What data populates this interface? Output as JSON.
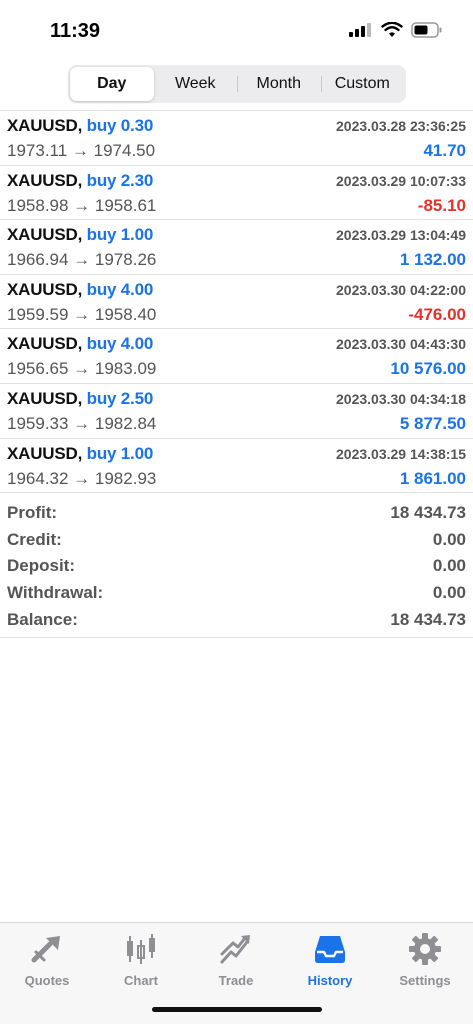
{
  "status": {
    "time": "11:39"
  },
  "segments": [
    "Day",
    "Week",
    "Month",
    "Custom"
  ],
  "deals": [
    {
      "symbol": "XAUUSD,",
      "side": "buy 0.30",
      "prices": "1973.11 → 1974.50",
      "date": "2023.03.28 23:36:25",
      "profit": "41.70",
      "sign": "pos"
    },
    {
      "symbol": "XAUUSD,",
      "side": "buy 2.30",
      "prices": "1958.98 → 1958.61",
      "date": "2023.03.29 10:07:33",
      "profit": "-85.10",
      "sign": "neg"
    },
    {
      "symbol": "XAUUSD,",
      "side": "buy 1.00",
      "prices": "1966.94 → 1978.26",
      "date": "2023.03.29 13:04:49",
      "profit": "1 132.00",
      "sign": "pos"
    },
    {
      "symbol": "XAUUSD,",
      "side": "buy 4.00",
      "prices": "1959.59 → 1958.40",
      "date": "2023.03.30 04:22:00",
      "profit": "-476.00",
      "sign": "neg"
    },
    {
      "symbol": "XAUUSD,",
      "side": "buy 4.00",
      "prices": "1956.65 → 1983.09",
      "date": "2023.03.30 04:43:30",
      "profit": "10 576.00",
      "sign": "pos"
    },
    {
      "symbol": "XAUUSD,",
      "side": "buy 2.50",
      "prices": "1959.33 → 1982.84",
      "date": "2023.03.30 04:34:18",
      "profit": "5 877.50",
      "sign": "pos"
    },
    {
      "symbol": "XAUUSD,",
      "side": "buy 1.00",
      "prices": "1964.32 → 1982.93",
      "date": "2023.03.29 14:38:15",
      "profit": "1 861.00",
      "sign": "pos"
    }
  ],
  "summary": [
    {
      "label": "Profit:",
      "value": "18 434.73"
    },
    {
      "label": "Credit:",
      "value": "0.00"
    },
    {
      "label": "Deposit:",
      "value": "0.00"
    },
    {
      "label": "Withdrawal:",
      "value": "0.00"
    },
    {
      "label": "Balance:",
      "value": "18 434.73"
    }
  ],
  "tabs": [
    {
      "label": "Quotes",
      "icon": "quotes-icon"
    },
    {
      "label": "Chart",
      "icon": "chart-icon"
    },
    {
      "label": "Trade",
      "icon": "trade-icon"
    },
    {
      "label": "History",
      "icon": "history-icon",
      "active": true
    },
    {
      "label": "Settings",
      "icon": "settings-icon"
    }
  ],
  "colors": {
    "accent": "#1a73e8",
    "negative": "#e0332c",
    "muted": "#8e8e93"
  }
}
